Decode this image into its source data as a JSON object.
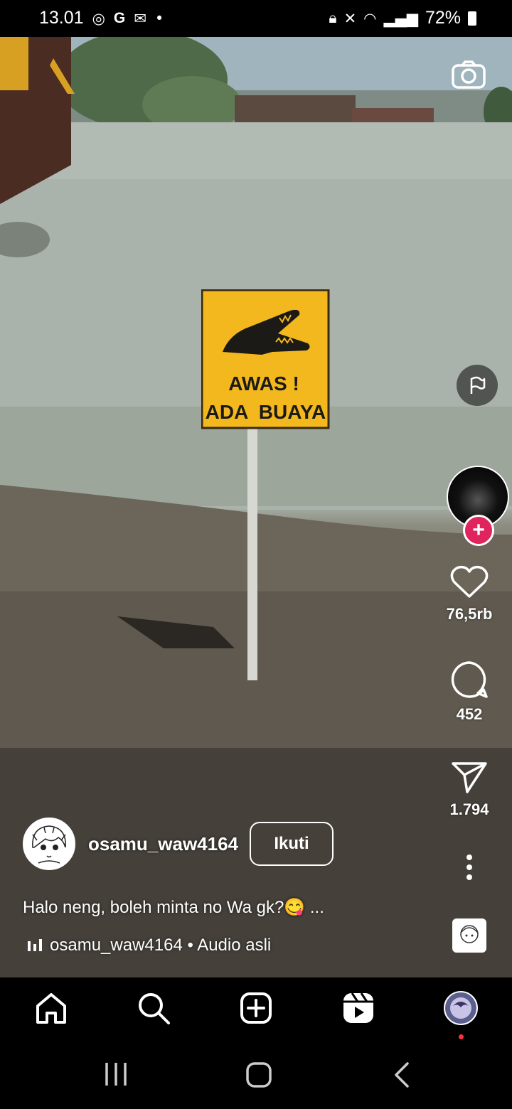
{
  "status_bar": {
    "time": "13.01",
    "left_icons": [
      "whatsapp-icon",
      "google-icon",
      "gmail-icon",
      "dot-icon"
    ],
    "right_icons": [
      "lock-icon",
      "mute-icon",
      "wifi-icon",
      "signal-icon"
    ],
    "battery": "72%"
  },
  "video": {
    "sign_line1": "AWAS !",
    "sign_line2_left": "ADA",
    "sign_line2_right": "BUAYA"
  },
  "actions": {
    "likes": "76,5rb",
    "comments": "452",
    "shares": "1.794"
  },
  "post": {
    "username": "osamu_waw4164",
    "follow_label": "Ikuti",
    "caption": "Halo neng, boleh minta no Wa gk?😋 ...",
    "audio": "osamu_waw4164 • Audio asli"
  },
  "nav": {
    "items": [
      "home-icon",
      "search-icon",
      "create-icon",
      "reels-icon",
      "profile-icon"
    ]
  },
  "colors": {
    "sign_yellow": "#f2b81e",
    "like_accent": "#e0245e",
    "notification_dot": "#ff3040"
  }
}
